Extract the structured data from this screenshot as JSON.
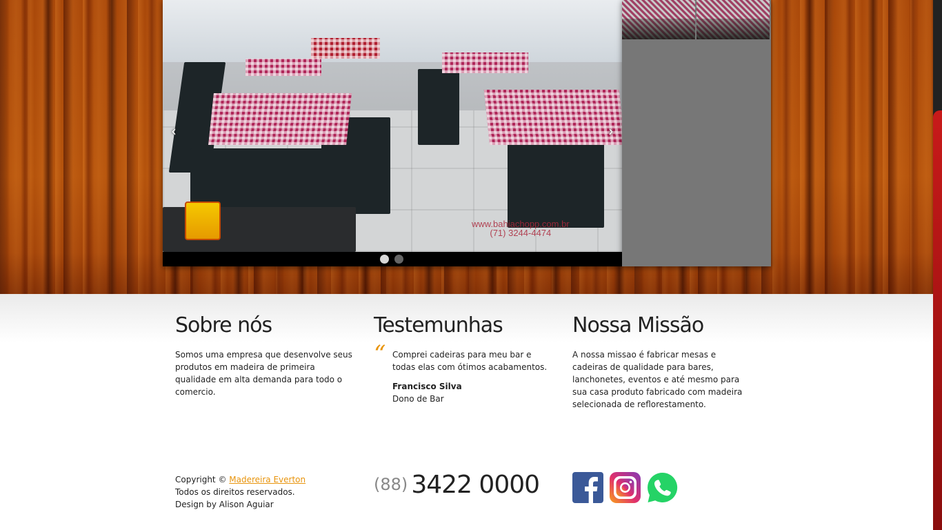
{
  "slider": {
    "prev_arrow": "‹",
    "next_arrow": "›",
    "watermark_line1": "www.bahiachopp.com.br",
    "watermark_line2": "(71) 3244-4474",
    "dots": 2,
    "active_dot": 1
  },
  "columns": {
    "about": {
      "title": "Sobre nós",
      "text": "Somos uma empresa que desenvolve seus produtos em madeira de primeira qualidade em alta demanda para todo o comercio."
    },
    "testimonials": {
      "title": "Testemunhas",
      "quote_mark": "“",
      "quote": "Comprei cadeiras para meu bar e todas elas com ótimos acabamentos.",
      "author": "Francisco Silva",
      "role": "Dono de Bar"
    },
    "mission": {
      "title": "Nossa Missão",
      "text": "A nossa missao é fabricar mesas e cadeiras de qualidade para bares, lanchonetes, eventos e até mesmo para sua casa produto fabricado com madeira selecionada de reflorestamento."
    }
  },
  "footer": {
    "copyright_prefix": "Copyright ©",
    "company_link": "Madereira Everton",
    "rights": "Todos os direitos reservados.",
    "design": "Design by Alison Aguiar",
    "phone_area": "(88)",
    "phone_number": "3422 0000"
  },
  "social": [
    {
      "name": "facebook-icon",
      "color": "#3b5998"
    },
    {
      "name": "instagram-icon",
      "color": "#c13584"
    },
    {
      "name": "whatsapp-icon",
      "color": "#25d366"
    }
  ],
  "colors": {
    "accent": "#e8940c",
    "thumb_panel": "#777777"
  }
}
